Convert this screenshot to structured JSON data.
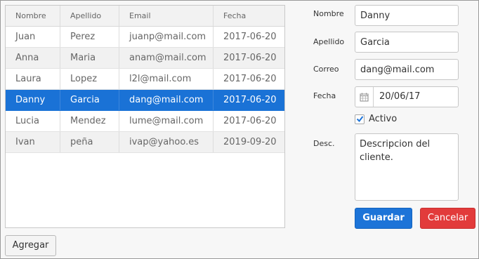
{
  "grid": {
    "columns": [
      "Nombre",
      "Apellido",
      "Email",
      "Fecha"
    ],
    "rows": [
      {
        "nombre": "Juan",
        "apellido": "Perez",
        "email": "juanp@mail.com",
        "fecha": "2017-06-20"
      },
      {
        "nombre": "Anna",
        "apellido": "Maria",
        "email": "anam@mail.com",
        "fecha": "2017-06-20"
      },
      {
        "nombre": "Laura",
        "apellido": "Lopez",
        "email": "l2l@mail.com",
        "fecha": "2017-06-20"
      },
      {
        "nombre": "Danny",
        "apellido": "Garcia",
        "email": "dang@mail.com",
        "fecha": "2017-06-20"
      },
      {
        "nombre": "Lucia",
        "apellido": "Mendez",
        "email": "lume@mail.com",
        "fecha": "2017-06-20"
      },
      {
        "nombre": "Ivan",
        "apellido": "peña",
        "email": "ivap@yahoo.es",
        "fecha": "2019-09-20"
      }
    ],
    "selected_row_index": 3
  },
  "form": {
    "nombre_label": "Nombre",
    "nombre_value": "Danny",
    "apellido_label": "Apellido",
    "apellido_value": "Garcia",
    "correo_label": "Correo",
    "correo_value": "dang@mail.com",
    "fecha_label": "Fecha",
    "fecha_value": "20/06/17",
    "activo_label": "Activo",
    "activo_checked": true,
    "desc_label": "Desc.",
    "desc_value": "Descripcion del cliente."
  },
  "buttons": {
    "save_label": "Guardar",
    "cancel_label": "Cancelar",
    "add_label": "Agregar"
  },
  "colors": {
    "selected_row": "#1a72d6",
    "save_button": "#1d74d8",
    "cancel_button": "#e23b3b",
    "checkbox_check": "#1d74d8"
  },
  "icons": {
    "date_button": "calendar-icon",
    "checkbox": "checkmark-icon"
  }
}
